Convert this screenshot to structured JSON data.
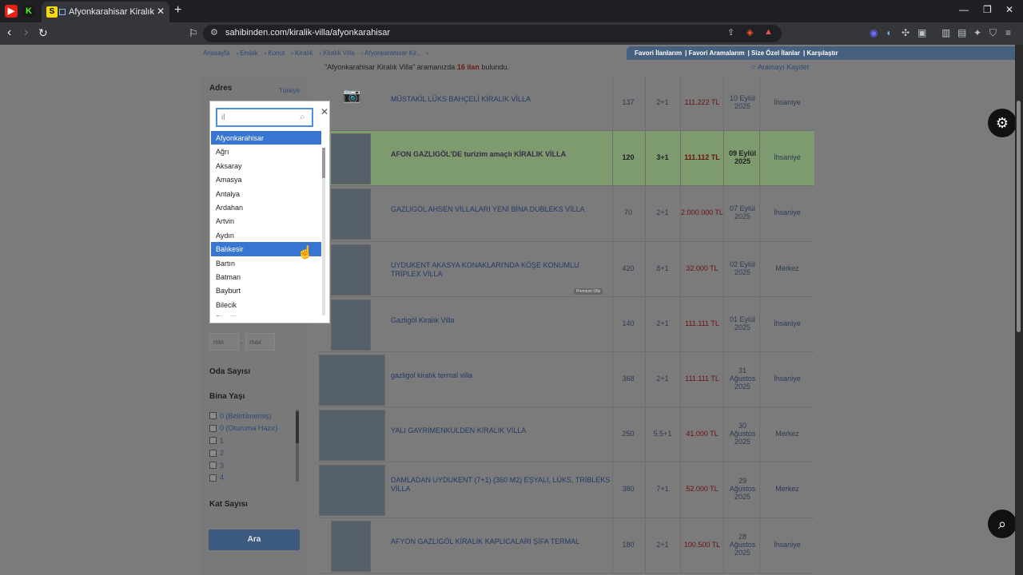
{
  "browser": {
    "tab_title": "Afyonkarahisar Kiralık Villa Fiy",
    "url": "sahibinden.com/kiralik-villa/afyonkarahisar"
  },
  "breadcrumb": [
    "Anasayfa",
    "Emlak",
    "Konut",
    "Kiralık",
    "Kiralık Villa",
    "Afyonkarahisar Kir.."
  ],
  "top_links": [
    "Favori İlanlarım",
    "Favori Aramalarım",
    "Size Özel İlanlar",
    "Karşılaştır"
  ],
  "result": {
    "query": "\"Afyonkarahisar Kiralık Villa\"",
    "mid": " aramanızda ",
    "count": "16 ilan",
    "end": " bulundu.",
    "save_label": "☆ Aramayı Kaydet"
  },
  "sidebar": {
    "adres_label": "Adres",
    "turkiye_label": "Türkiye",
    "min_placeholder": "min",
    "max_placeholder": "max",
    "oda_label": "Oda Sayısı",
    "bina_label": "Bina Yaşı",
    "bina_options": [
      "0 (Belirtilmemiş)",
      "0 (Oturuma Hazır)",
      "1",
      "2",
      "3",
      "4"
    ],
    "kat_label": "Kat Sayısı",
    "ara_label": "Ara"
  },
  "dropdown": {
    "search_value": "il",
    "items": [
      "Afyonkarahisar",
      "Ağrı",
      "Aksaray",
      "Amasya",
      "Antalya",
      "Ardahan",
      "Artvin",
      "Aydın",
      "Balıkesir",
      "Bartın",
      "Batman",
      "Bayburt",
      "Bilecik",
      "Bingöl"
    ],
    "selected_items": [
      "Afyonkarahisar",
      "Balıkesir"
    ]
  },
  "listings": [
    {
      "title": "MÜSTAKİL LÜKS BAHÇELİ KİRALIK VİLLA",
      "m2": "137",
      "rooms": "2+1",
      "price": "111.222 TL",
      "date": "10 Eylül 2025",
      "district": "İhsaniye",
      "thumb": "camera"
    },
    {
      "title": "AFON GAZLIGÖL'DE turizim amaçlı KİRALIK VİLLA",
      "m2": "120",
      "rooms": "3+1",
      "price": "111.112 TL",
      "date": "09 Eylül 2025",
      "district": "İhsaniye",
      "thumb": "photo"
    },
    {
      "title": "GAZLIGÖL AHSEN VİLLALARI YENİ BİNA DUBLEKS VİLLA",
      "m2": "70",
      "rooms": "2+1",
      "price": "2.000.000 TL",
      "date": "07 Eylül 2025",
      "district": "İhsaniye",
      "thumb": "photo"
    },
    {
      "title": "UYDUKENT AKASYA KONAKLARI'NDA KÖŞE KONUMLU TRİPLEX VİLLA",
      "m2": "420",
      "rooms": "8+1",
      "price": "32.000 TL",
      "date": "02 Eylül 2025",
      "district": "Merkez",
      "thumb": "photo",
      "badge": "Premium Ofis"
    },
    {
      "title": "Gazligöl Kiralık Villa",
      "m2": "140",
      "rooms": "2+1",
      "price": "111.111 TL",
      "date": "01 Eylül 2025",
      "district": "İhsaniye",
      "thumb": "photo"
    },
    {
      "title": "gazligol kiralık termal villa",
      "m2": "368",
      "rooms": "2+1",
      "price": "111.111 TL",
      "date": "31 Ağustos 2025",
      "district": "İhsaniye",
      "thumb": "wide"
    },
    {
      "title": "YALI GAYRİMENKULDEN KİRALIK VİLLA",
      "m2": "250",
      "rooms": "5.5+1",
      "price": "41.000 TL",
      "date": "30 Ağustos 2025",
      "district": "Merkez",
      "thumb": "wide"
    },
    {
      "title": "DAMLADAN UYDUKENT (7+1) (360 M2) EŞYALI, LÜKS, TRİBLEKS VİLLA",
      "m2": "380",
      "rooms": "7+1",
      "price": "52.000 TL",
      "date": "29 Ağustos 2025",
      "district": "Merkez",
      "thumb": "wide"
    },
    {
      "title": "AFYON GAZLIGÖL KİRALIK KAPLICALARI ŞİFA TERMAL",
      "m2": "180",
      "rooms": "2+1",
      "price": "100.500 TL",
      "date": "28 Ağustos 2025",
      "district": "İhsaniye",
      "thumb": "photo"
    }
  ]
}
